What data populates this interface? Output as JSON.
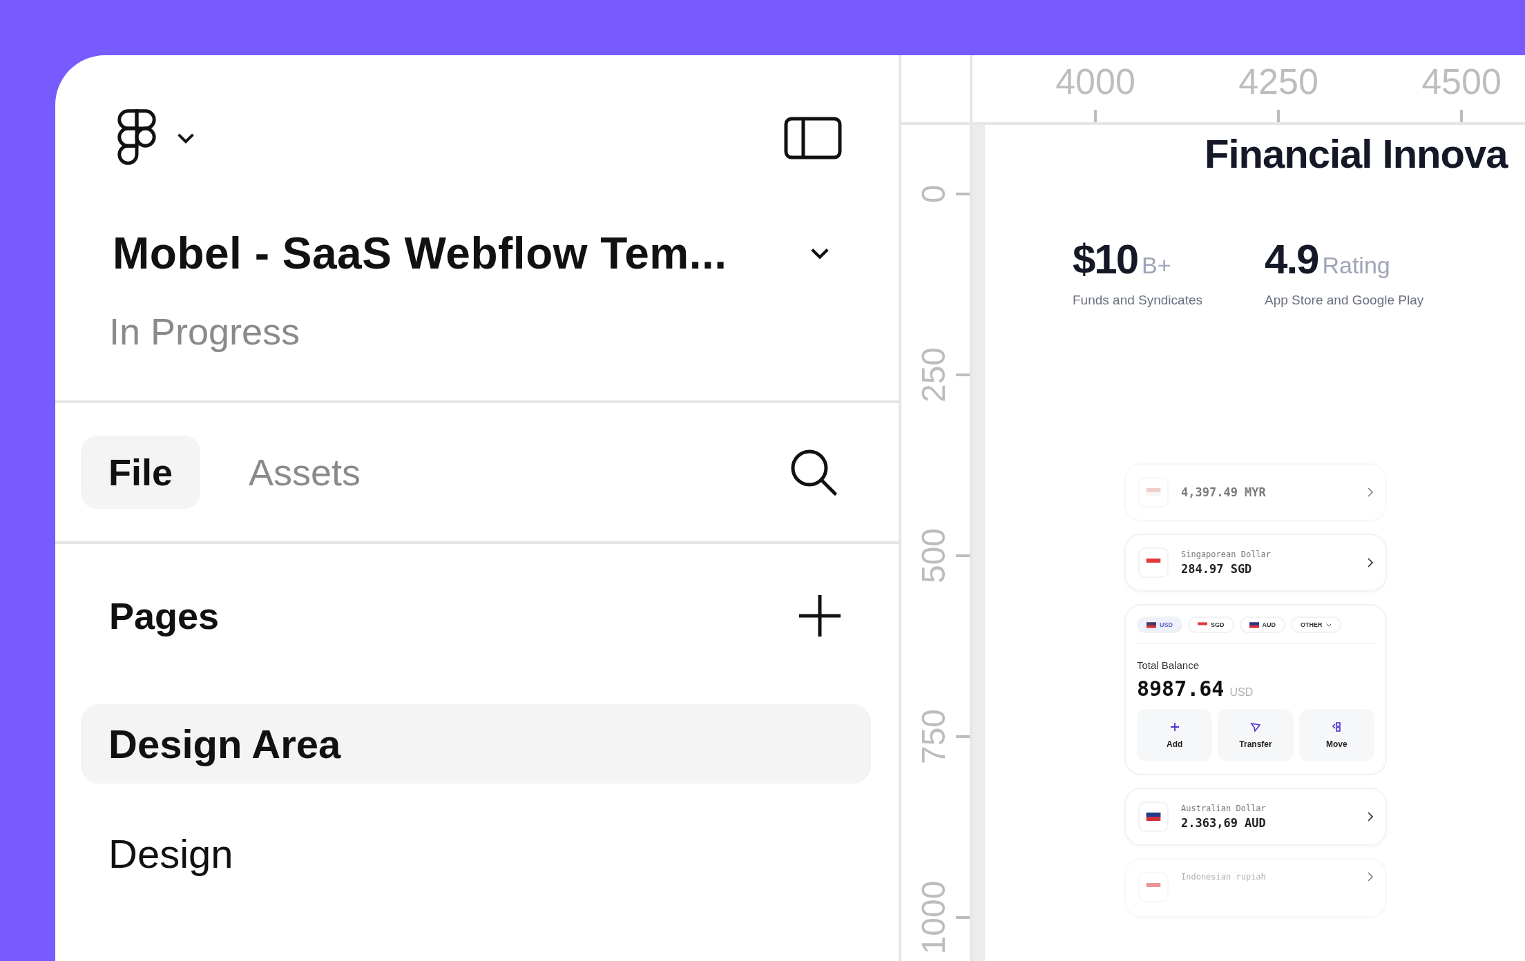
{
  "file": {
    "title": "Mobel - SaaS Webflow Tem...",
    "status": "In Progress"
  },
  "tabs": [
    {
      "label": "File",
      "selected": true
    },
    {
      "label": "Assets",
      "selected": false
    }
  ],
  "pages": {
    "heading": "Pages",
    "items": [
      {
        "label": "Design Area",
        "selected": true
      },
      {
        "label": "Design",
        "selected": false
      }
    ]
  },
  "rulers": {
    "horizontal": [
      "4000",
      "4250",
      "4500"
    ],
    "vertical": [
      "0",
      "250",
      "500",
      "750",
      "1000"
    ]
  },
  "canvas": {
    "heading": "Financial Innova",
    "stats": [
      {
        "value": "$10",
        "unit": "B+",
        "caption": "Funds and Syndicates"
      },
      {
        "value": "4.9",
        "unit": "Rating",
        "caption": "App Store and Google Play"
      }
    ],
    "accounts_top": [
      {
        "amount": "4,397.49 MYR",
        "faded": true
      },
      {
        "name": "Singaporean Dollar",
        "amount": "284.97 SGD",
        "faded": false
      }
    ],
    "balance": {
      "chips": [
        {
          "kind": "currency",
          "label": "USD",
          "selected": true
        },
        {
          "kind": "currency",
          "label": "SGD",
          "selected": false
        },
        {
          "kind": "currency",
          "label": "AUD",
          "selected": false
        },
        {
          "kind": "dropdown",
          "label": "OTHER",
          "selected": false
        }
      ],
      "label": "Total Balance",
      "amount": "8987.64",
      "currency": "USD",
      "actions": [
        {
          "label": "Add"
        },
        {
          "label": "Transfer"
        },
        {
          "label": "Move"
        }
      ]
    },
    "accounts_bottom": [
      {
        "name": "Australian Dollar",
        "amount": "2.363,69 AUD",
        "faded": false
      },
      {
        "name": "Indonesian rupiah",
        "faded": true
      }
    ]
  }
}
